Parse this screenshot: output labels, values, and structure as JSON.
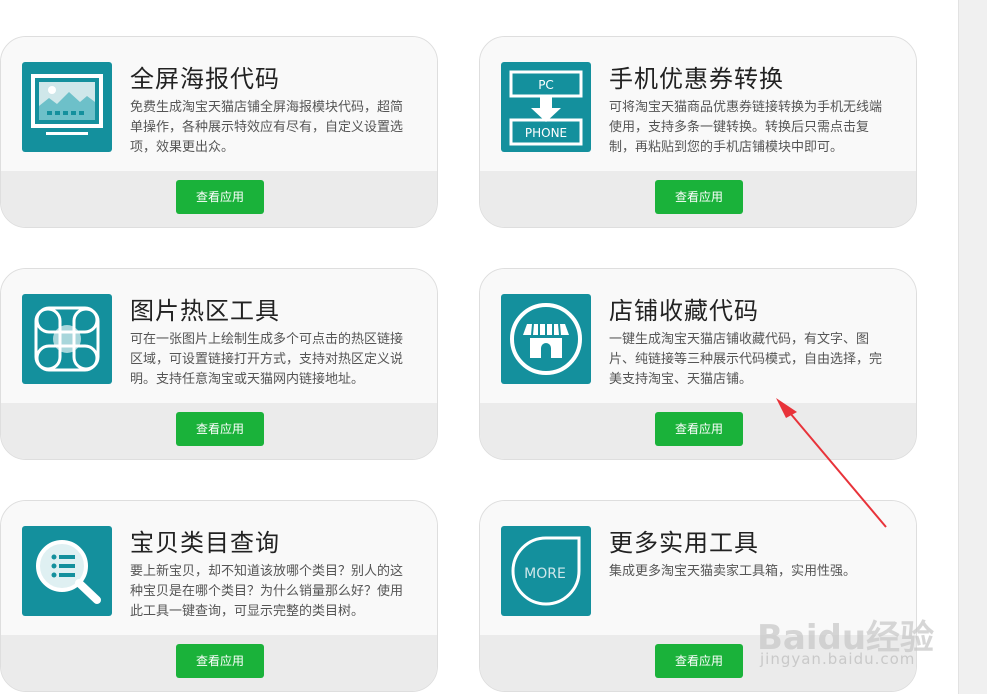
{
  "cards": [
    {
      "title": "全屏海报代码",
      "desc": "免费生成淘宝天猫店铺全屏海报模块代码，超简单操作，各种展示特效应有尽有，自定义设置选项，效果更出众。",
      "button": "查看应用",
      "icon": "poster-icon"
    },
    {
      "title": "手机优惠券转换",
      "desc": "可将淘宝天猫商品优惠券链接转换为手机无线端使用，支持多条一键转换。转换后只需点击复制，再粘贴到您的手机店铺模块中即可。",
      "button": "查看应用",
      "icon": "pc-phone-icon",
      "icon_text": {
        "top": "PC",
        "bottom": "PHONE"
      }
    },
    {
      "title": "图片热区工具",
      "desc": "可在一张图片上绘制生成多个可点击的热区链接区域，可设置链接打开方式，支持对热区定义说明。支持任意淘宝或天猫网内链接地址。",
      "button": "查看应用",
      "icon": "hotspot-icon"
    },
    {
      "title": "店铺收藏代码",
      "desc": "一键生成淘宝天猫店铺收藏代码，有文字、图片、纯链接等三种展示代码模式，自由选择，完美支持淘宝、天猫店铺。",
      "button": "查看应用",
      "icon": "store-icon"
    },
    {
      "title": "宝贝类目查询",
      "desc": "要上新宝贝，却不知道该放哪个类目？别人的这种宝贝是在哪个类目？为什么销量那么好？使用此工具一键查询，可显示完整的类目树。",
      "button": "查看应用",
      "icon": "magnifier-list-icon"
    },
    {
      "title": "更多实用工具",
      "desc": "集成更多淘宝天猫卖家工具箱，实用性强。",
      "button": "查看应用",
      "icon": "more-icon",
      "icon_text": {
        "label": "MORE"
      }
    }
  ],
  "watermark": {
    "brand": "Baidu经验",
    "url": "jingyan.baidu.com"
  },
  "colors": {
    "icon_bg": "#14909d",
    "button": "#1ab23a",
    "arrow": "#e8333a"
  }
}
